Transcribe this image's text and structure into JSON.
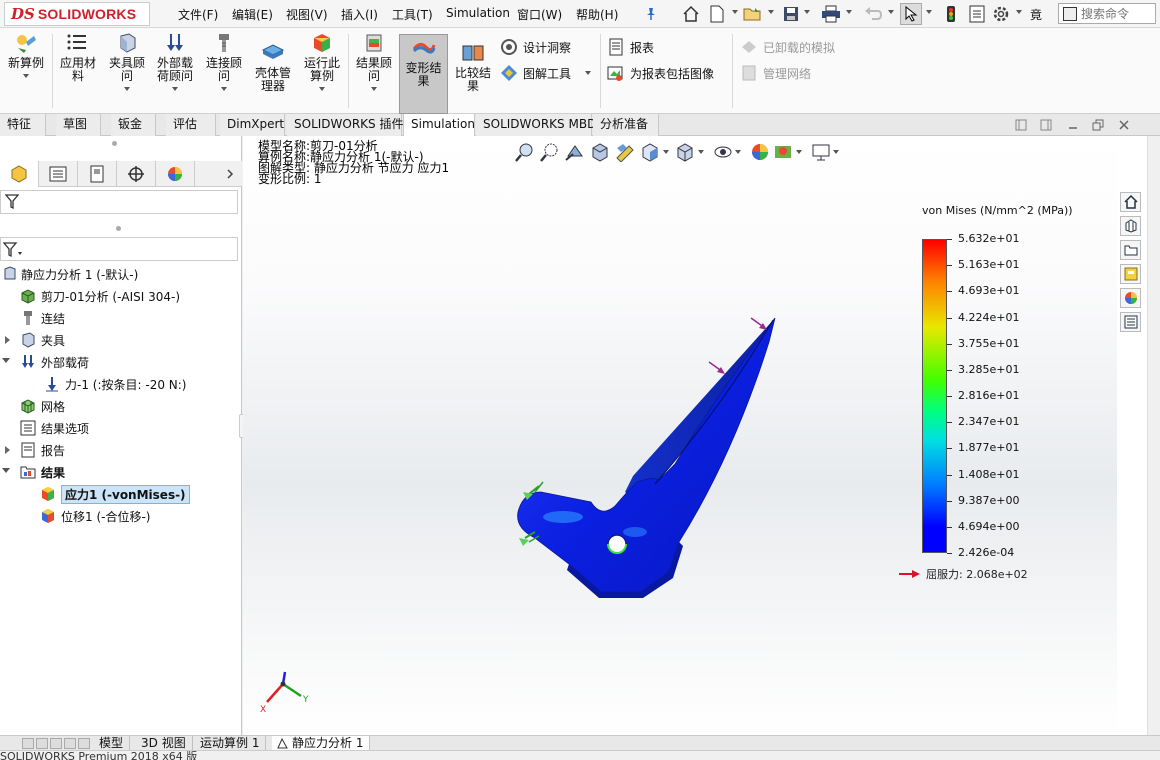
{
  "app": {
    "logo_text": "SOLIDWORKS",
    "logo_prefix": "DS",
    "menu": [
      "文件(F)",
      "编辑(E)",
      "视图(V)",
      "插入(I)",
      "工具(T)",
      "Simulation",
      "窗口(W)",
      "帮助(H)"
    ],
    "search_label": "搜索命令",
    "truncated_label": "竟"
  },
  "ribbon": {
    "new_study": "新算例",
    "apply_material": "应用材料",
    "fixtures_advisor": "夹具顾问",
    "external_loads_advisor": "外部载荷顾问",
    "connections_advisor": "连接顾问",
    "shell_manager": "壳体管理器",
    "run_study": "运行此算例",
    "results_advisor": "结果顾问",
    "deformed_result": "变形结果",
    "compare_results": "比较结果",
    "design_insight": "设计洞察",
    "plot_tools": "图解工具",
    "report": "报表",
    "include_image_report": "为报表包括图像",
    "unloaded_sims": "已卸载的模拟",
    "manage_network": "管理网络"
  },
  "tabs": [
    {
      "label": "特征",
      "active": false
    },
    {
      "label": "草图",
      "active": false
    },
    {
      "label": "钣金",
      "active": false
    },
    {
      "label": "评估",
      "active": false
    },
    {
      "label": "DimXpert",
      "active": false
    },
    {
      "label": "SOLIDWORKS 插件",
      "active": false
    },
    {
      "label": "Simulation",
      "active": true
    },
    {
      "label": "SOLIDWORKS MBD",
      "active": false
    },
    {
      "label": "分析准备",
      "active": false
    }
  ],
  "tree": {
    "study": "静应力分析 1 (-默认-)",
    "part": "剪刀-01分析 (-AISI 304-)",
    "connections": "连结",
    "fixtures": "夹具",
    "external_loads": "外部载荷",
    "force": "力-1 (:按条目: -20 N:)",
    "mesh": "网格",
    "result_options": "结果选项",
    "report": "报告",
    "results": "结果",
    "stress": "应力1 (-vonMises-)",
    "displacement": "位移1 (-合位移-)"
  },
  "plot_info": {
    "model_name": "模型名称:剪刀-01分析",
    "study_name": "算例名称:静应力分析 1(-默认-)",
    "plot_type": "图解类型: 静应力分析 节应力 应力1",
    "deformation_scale": "变形比例: 1"
  },
  "legend": {
    "title": "von Mises (N/mm^2 (MPa))",
    "ticks": [
      "5.632e+01",
      "5.163e+01",
      "4.693e+01",
      "4.224e+01",
      "3.755e+01",
      "3.285e+01",
      "2.816e+01",
      "2.347e+01",
      "1.877e+01",
      "1.408e+01",
      "9.387e+00",
      "4.694e+00",
      "2.426e-04"
    ],
    "max_value": 56.32,
    "min_value": 0.0002426,
    "yield_label": "屈服力: 2.068e+02"
  },
  "triad": {
    "x": "X",
    "y": "Y"
  },
  "bottom_tabs": [
    {
      "label": "模型",
      "active": false
    },
    {
      "label": "3D 视图",
      "active": false
    },
    {
      "label": "运动算例 1",
      "active": false
    },
    {
      "label": "静应力分析 1",
      "active": true
    }
  ],
  "status": "SOLIDWORKS Premium 2018 x64 版",
  "colors": {
    "brand_red": "#d0202a",
    "selection": "#cce4f7",
    "part_blue": "#0a1fe0"
  }
}
